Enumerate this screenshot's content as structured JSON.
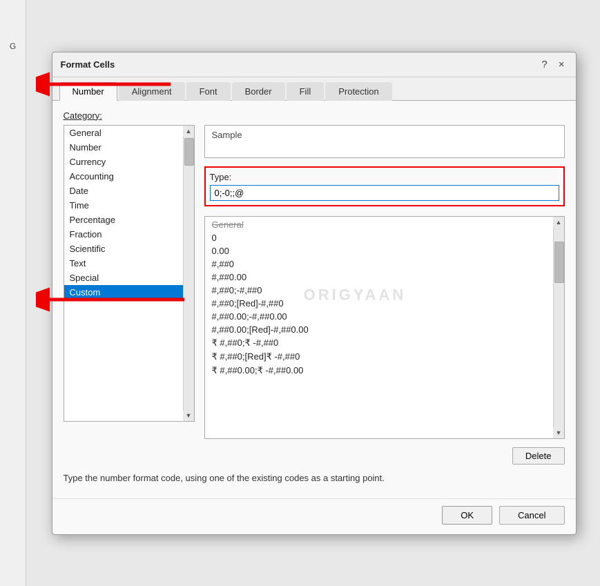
{
  "dialog": {
    "title": "Format Cells",
    "help_label": "?",
    "close_label": "×"
  },
  "tabs": {
    "items": [
      {
        "id": "number",
        "label": "Number",
        "active": true
      },
      {
        "id": "alignment",
        "label": "Alignment",
        "active": false
      },
      {
        "id": "font",
        "label": "Font",
        "active": false
      },
      {
        "id": "border",
        "label": "Border",
        "active": false
      },
      {
        "id": "fill",
        "label": "Fill",
        "active": false
      },
      {
        "id": "protection",
        "label": "Protection",
        "active": false
      }
    ]
  },
  "category_label": "Category:",
  "categories": [
    {
      "label": "General",
      "selected": false
    },
    {
      "label": "Number",
      "selected": false
    },
    {
      "label": "Currency",
      "selected": false
    },
    {
      "label": "Accounting",
      "selected": false
    },
    {
      "label": "Date",
      "selected": false
    },
    {
      "label": "Time",
      "selected": false
    },
    {
      "label": "Percentage",
      "selected": false
    },
    {
      "label": "Fraction",
      "selected": false
    },
    {
      "label": "Scientific",
      "selected": false
    },
    {
      "label": "Text",
      "selected": false
    },
    {
      "label": "Special",
      "selected": false
    },
    {
      "label": "Custom",
      "selected": true
    }
  ],
  "sample_label": "Sample",
  "type_label": "Type:",
  "type_value": "0;-0;;@",
  "format_list": [
    {
      "label": "General",
      "strikethrough": true
    },
    {
      "label": "0",
      "strikethrough": false
    },
    {
      "label": "0.00",
      "strikethrough": false
    },
    {
      "label": "#,##0",
      "strikethrough": false
    },
    {
      "label": "#,##0.00",
      "strikethrough": false
    },
    {
      "label": "#,##0;-#,##0",
      "strikethrough": false
    },
    {
      "label": "#,##0;[Red]-#,##0",
      "strikethrough": false
    },
    {
      "label": "#,##0.00;-#,##0.00",
      "strikethrough": false
    },
    {
      "label": "#,##0.00;[Red]-#,##0.00",
      "strikethrough": false
    },
    {
      "label": "₹ #,##0;₹ -#,##0",
      "strikethrough": false
    },
    {
      "label": "₹ #,##0;[Red]₹ -#,##0",
      "strikethrough": false
    },
    {
      "label": "₹ #,##0.00;₹ -#,##0.00",
      "strikethrough": false
    }
  ],
  "delete_btn_label": "Delete",
  "hint_text": "Type the number format code, using one of the existing codes as a starting point.",
  "ok_label": "OK",
  "cancel_label": "Cancel",
  "watermark": "ORIGYAAN"
}
